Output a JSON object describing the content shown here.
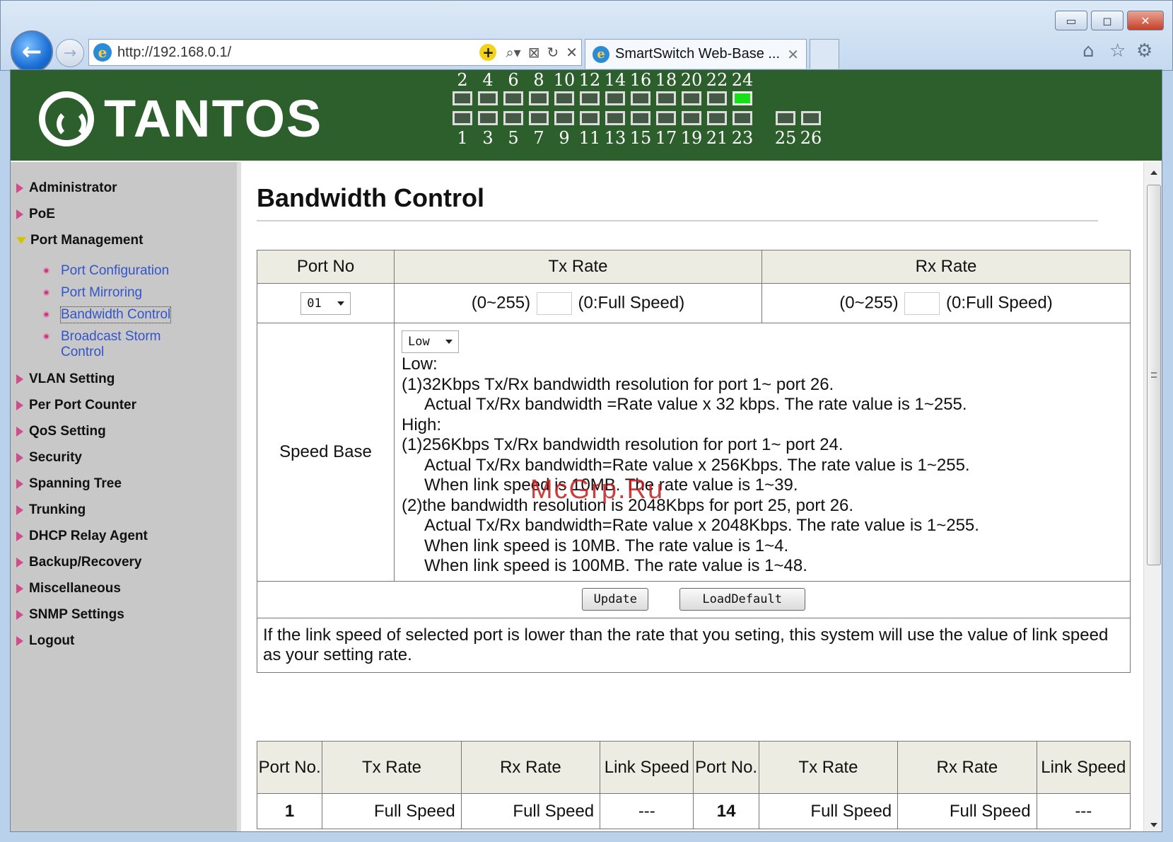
{
  "browser": {
    "address": "http://192.168.0.1/",
    "tab_title": "SmartSwitch Web-Base ...",
    "window_buttons": {
      "minimize": "▭",
      "maximize": "◻",
      "close": "✕"
    },
    "icons": [
      "back-icon",
      "forward-icon",
      "ie-icon",
      "add-icon",
      "search-icon",
      "compat-icon",
      "refresh-icon",
      "stop-icon",
      "home-icon",
      "star-icon",
      "gear-icon"
    ]
  },
  "banner": {
    "logo_text": "TANTOS",
    "brand_color": "#2d5f2c",
    "ports_top": [
      "2",
      "4",
      "6",
      "8",
      "10",
      "12",
      "14",
      "16",
      "18",
      "20",
      "22",
      "24"
    ],
    "ports_bottom": [
      "1",
      "3",
      "5",
      "7",
      "9",
      "11",
      "13",
      "15",
      "17",
      "19",
      "21",
      "23"
    ],
    "ports_extra": [
      "25",
      "26"
    ],
    "active_ports": [
      "24"
    ]
  },
  "sidebar": {
    "items": [
      {
        "label": "Administrator"
      },
      {
        "label": "PoE"
      },
      {
        "label": "Port Management",
        "expanded": true,
        "children": [
          {
            "label": "Port Configuration"
          },
          {
            "label": "Port Mirroring"
          },
          {
            "label": "Bandwidth Control",
            "current": true
          },
          {
            "label": "Broadcast Storm Control"
          }
        ]
      },
      {
        "label": "VLAN Setting"
      },
      {
        "label": "Per Port Counter"
      },
      {
        "label": "QoS Setting"
      },
      {
        "label": "Security"
      },
      {
        "label": "Spanning Tree"
      },
      {
        "label": "Trunking"
      },
      {
        "label": "DHCP Relay Agent"
      },
      {
        "label": "Backup/Recovery"
      },
      {
        "label": "Miscellaneous"
      },
      {
        "label": "SNMP Settings"
      },
      {
        "label": "Logout"
      }
    ]
  },
  "main": {
    "title": "Bandwidth Control",
    "form": {
      "headers": {
        "port": "Port No",
        "tx": "Tx Rate",
        "rx": "Rx Rate"
      },
      "port_select": "01",
      "tx": {
        "prefix": "(0~255)",
        "suffix": "(0:Full Speed)",
        "value": ""
      },
      "rx": {
        "prefix": "(0~255)",
        "suffix": "(0:Full Speed)",
        "value": ""
      },
      "speed_base_label": "Speed Base",
      "speed_base_select": "Low",
      "speed_base_lines": [
        {
          "text": "Low:",
          "indent": false
        },
        {
          "text": "(1)32Kbps Tx/Rx bandwidth resolution for port 1~ port 26.",
          "indent": false
        },
        {
          "text": "Actual Tx/Rx bandwidth =Rate value x 32 kbps. The rate value is 1~255.",
          "indent": true
        },
        {
          "text": "High:",
          "indent": false
        },
        {
          "text": "(1)256Kbps Tx/Rx bandwidth resolution for port 1~ port 24.",
          "indent": false
        },
        {
          "text": "Actual Tx/Rx bandwidth=Rate value x 256Kbps. The rate value is 1~255.",
          "indent": true
        },
        {
          "text": "When link speed is 10MB. The rate value is 1~39.",
          "indent": true
        },
        {
          "text": "(2)the bandwidth resolution is 2048Kbps for port 25, port 26.",
          "indent": false
        },
        {
          "text": "Actual Tx/Rx bandwidth=Rate value x 2048Kbps. The rate value is 1~255.",
          "indent": true
        },
        {
          "text": "When link speed is 10MB. The rate value is 1~4.",
          "indent": true
        },
        {
          "text": "When link speed is 100MB. The rate value is 1~48.",
          "indent": true
        }
      ],
      "update_label": "Update",
      "load_default_label": "LoadDefault",
      "note": "If the link speed of selected port is lower than the rate that you seting, this system will use the value of link speed as your setting rate."
    },
    "status_table": {
      "headers": [
        "Port No.",
        "Tx  Rate",
        "Rx  Rate",
        "Link Speed",
        "Port No.",
        "Tx  Rate",
        "Rx  Rate",
        "Link Speed"
      ],
      "rows": [
        [
          "1",
          "Full Speed",
          "Full Speed",
          "---",
          "14",
          "Full Speed",
          "Full Speed",
          "---"
        ]
      ]
    }
  },
  "watermark": "McGrp.Ru"
}
